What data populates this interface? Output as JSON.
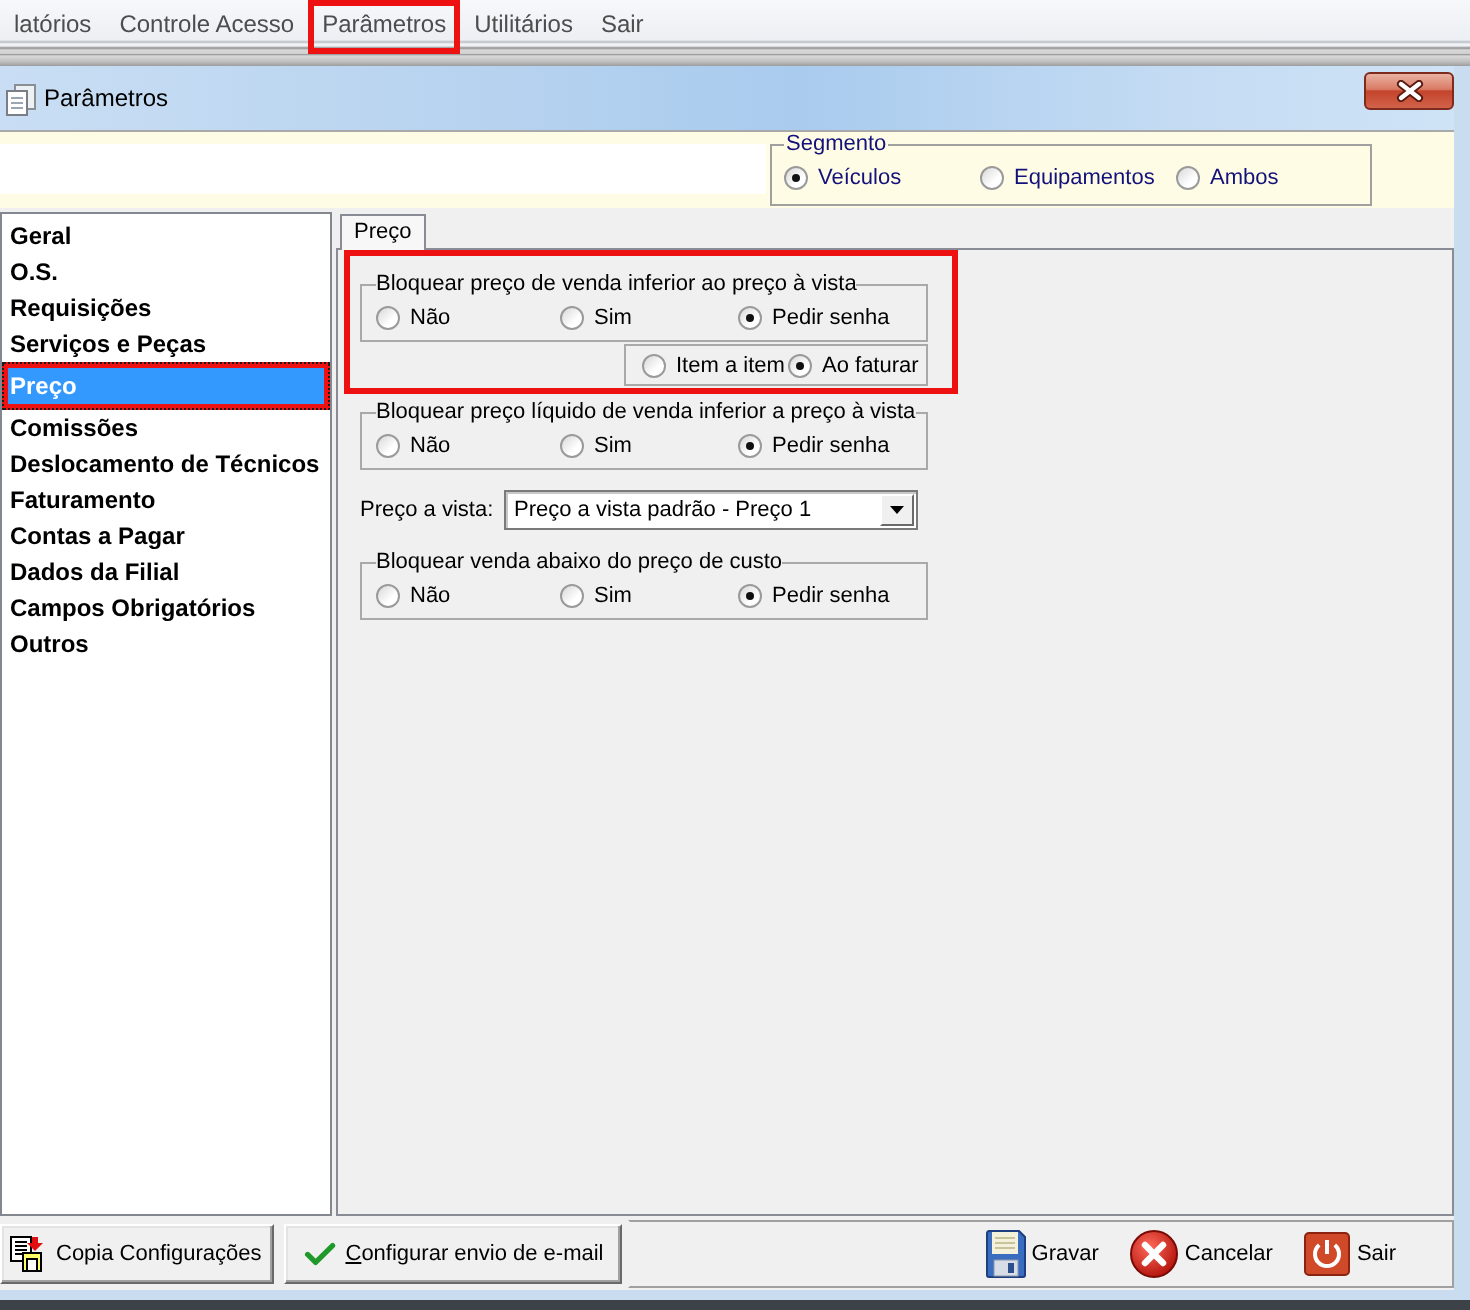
{
  "menu_bar": {
    "items": [
      {
        "label": "latórios",
        "highlighted": false
      },
      {
        "label": "Controle Acesso",
        "highlighted": false
      },
      {
        "label": "Parâmetros",
        "highlighted": true
      },
      {
        "label": "Utilitários",
        "highlighted": false
      },
      {
        "label": "Sair",
        "highlighted": false
      }
    ]
  },
  "window": {
    "title": "Parâmetros"
  },
  "segment": {
    "legend": "Segmento",
    "options": [
      {
        "label": "Veículos",
        "selected": true
      },
      {
        "label": "Equipamentos",
        "selected": false
      },
      {
        "label": "Ambos",
        "selected": false
      }
    ]
  },
  "sidebar": {
    "items": [
      {
        "label": "Geral",
        "selected": false,
        "highlighted": false
      },
      {
        "label": "O.S.",
        "selected": false,
        "highlighted": false
      },
      {
        "label": "Requisições",
        "selected": false,
        "highlighted": false
      },
      {
        "label": "Serviços e Peças",
        "selected": false,
        "highlighted": false
      },
      {
        "label": "Preço",
        "selected": true,
        "highlighted": true
      },
      {
        "label": "Comissões",
        "selected": false,
        "highlighted": false
      },
      {
        "label": "Deslocamento de Técnicos",
        "selected": false,
        "highlighted": false
      },
      {
        "label": "Faturamento",
        "selected": false,
        "highlighted": false
      },
      {
        "label": "Contas a Pagar",
        "selected": false,
        "highlighted": false
      },
      {
        "label": "Dados da Filial",
        "selected": false,
        "highlighted": false
      },
      {
        "label": "Campos Obrigatórios",
        "selected": false,
        "highlighted": false
      },
      {
        "label": "Outros",
        "selected": false,
        "highlighted": false
      }
    ]
  },
  "tabs": [
    {
      "label": "Preço",
      "selected": true
    }
  ],
  "settings": [
    {
      "kind": "radio_group",
      "legend": "Bloquear preço de venda inferior ao preço à vista",
      "highlighted": true,
      "options": [
        {
          "label": "Não",
          "selected": false
        },
        {
          "label": "Sim",
          "selected": false
        },
        {
          "label": "Pedir senha",
          "selected": true
        }
      ],
      "sub_options": [
        {
          "label": "Item a item",
          "selected": false
        },
        {
          "label": "Ao faturar",
          "selected": true
        }
      ]
    },
    {
      "kind": "radio_group",
      "legend": "Bloquear preço líquido de venda inferior a preço à vista",
      "highlighted": false,
      "options": [
        {
          "label": "Não",
          "selected": false
        },
        {
          "label": "Sim",
          "selected": false
        },
        {
          "label": "Pedir senha",
          "selected": true
        }
      ]
    },
    {
      "kind": "dropdown",
      "label": "Preço a vista:",
      "value": "Preço a vista padrão - Preço 1"
    },
    {
      "kind": "radio_group",
      "legend": "Bloquear venda abaixo do preço de custo",
      "highlighted": false,
      "options": [
        {
          "label": "Não",
          "selected": false
        },
        {
          "label": "Sim",
          "selected": false
        },
        {
          "label": "Pedir senha",
          "selected": true
        }
      ]
    }
  ],
  "footer": {
    "buttons": [
      {
        "label": "Copia Configurações",
        "mnemonic_underlined": false
      },
      {
        "label": "Configurar envio de e-mail",
        "mnemonic_underlined": true
      }
    ],
    "actions": [
      "Gravar",
      "Cancelar",
      "Sair"
    ]
  }
}
